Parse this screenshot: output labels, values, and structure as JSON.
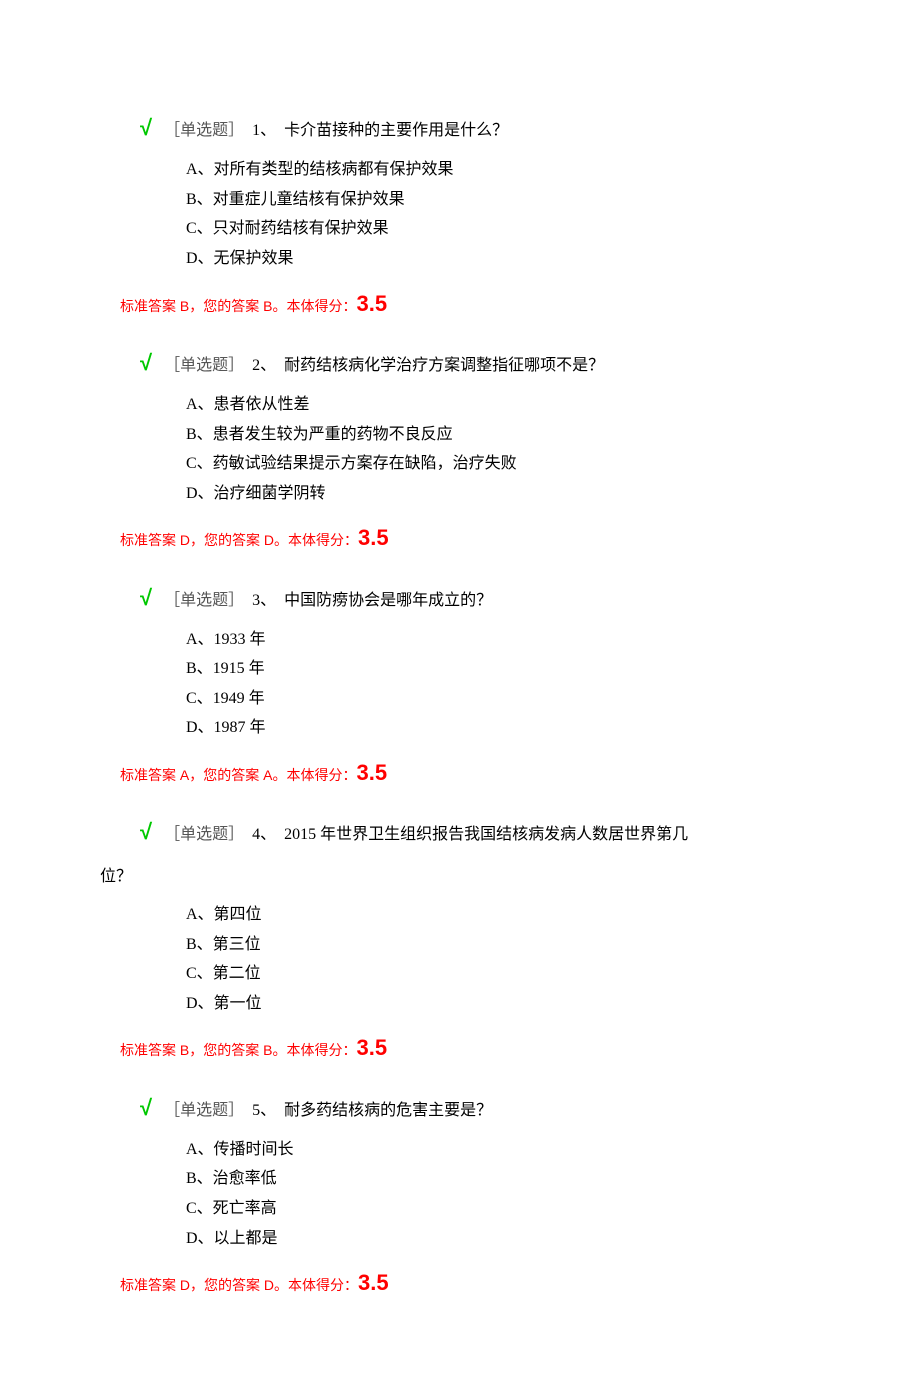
{
  "questions": [
    {
      "check": "√",
      "tag": "［单选题］",
      "num": "1、",
      "text": "卡介苗接种的主要作用是什么？",
      "options": [
        "A、对所有类型的结核病都有保护效果",
        "B、对重症儿童结核有保护效果",
        "C、只对耐药结核有保护效果",
        "D、无保护效果"
      ],
      "answer_prefix": "标准答案 B，您的答案 B。本体得分：",
      "score": "3.5"
    },
    {
      "check": "√",
      "tag": "［单选题］",
      "num": "2、",
      "text": "耐药结核病化学治疗方案调整指征哪项不是？",
      "options": [
        "A、患者依从性差",
        "B、患者发生较为严重的药物不良反应",
        "C、药敏试验结果提示方案存在缺陷，治疗失败",
        "D、治疗细菌学阴转"
      ],
      "answer_prefix": "标准答案 D，您的答案 D。本体得分：",
      "score": "3.5"
    },
    {
      "check": "√",
      "tag": "［单选题］",
      "num": "3、",
      "text": "中国防痨协会是哪年成立的？",
      "options": [
        "A、1933 年",
        "B、1915 年",
        "C、1949 年",
        "D、1987 年"
      ],
      "answer_prefix": "标准答案 A，您的答案 A。本体得分：",
      "score": "3.5"
    },
    {
      "check": "√",
      "tag": "［单选题］",
      "num": "4、",
      "text": "2015 年世界卫生组织报告我国结核病发病人数居世界第几",
      "text_wrap": "位？",
      "options": [
        "A、第四位",
        "B、第三位",
        "C、第二位",
        "D、第一位"
      ],
      "answer_prefix": "标准答案 B，您的答案 B。本体得分：",
      "score": "3.5"
    },
    {
      "check": "√",
      "tag": "［单选题］",
      "num": "5、",
      "text": "耐多药结核病的危害主要是？",
      "options": [
        "A、传播时间长",
        "B、治愈率低",
        "C、死亡率高",
        "D、以上都是"
      ],
      "answer_prefix": "标准答案 D，您的答案 D。本体得分：",
      "score": "3.5"
    }
  ]
}
